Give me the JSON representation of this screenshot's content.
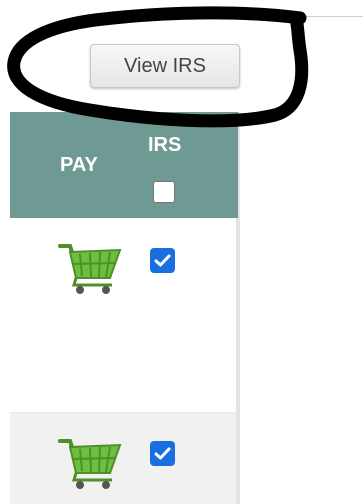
{
  "toolbar": {
    "view_irs_label": "View IRS"
  },
  "table": {
    "columns": [
      {
        "label": "PAY"
      },
      {
        "label": "IRS"
      }
    ],
    "header_irs_checked": false,
    "rows": [
      {
        "pay_icon": "shopping-cart-icon",
        "irs_checked": true
      },
      {
        "pay_icon": "shopping-cart-icon",
        "irs_checked": true
      }
    ]
  },
  "colors": {
    "header_bg": "#6f9a94",
    "checkbox_checked": "#1a6fe0",
    "cart_green": "#6cbf3f",
    "annotation_ink": "#000000"
  }
}
